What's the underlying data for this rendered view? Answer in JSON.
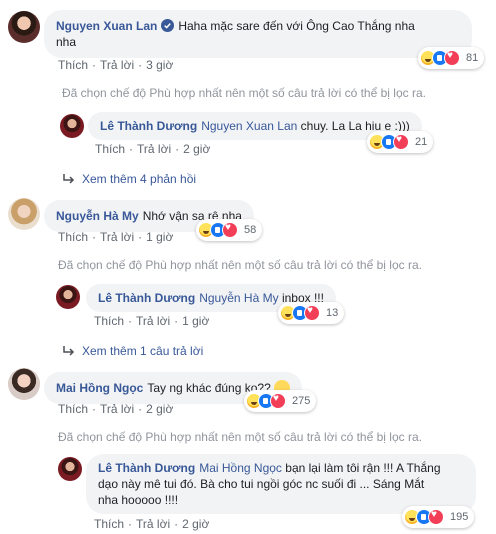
{
  "actions": {
    "like": "Thích",
    "reply": "Trả lời",
    "dot": "·"
  },
  "filter_note": "Đã chọn chế độ Phù hợp nhất nên một số câu trả lời có thể bị lọc ra.",
  "comments": [
    {
      "author": "Nguyen Xuan Lan",
      "verified": true,
      "text_line1": "Haha mặc sare đến với Ông Cao Thắng nha",
      "text_line2": "nha",
      "time": "3 giờ",
      "reaction_count": "81",
      "reply": {
        "author": "Lê Thành Dương",
        "mention": "Nguyen Xuan Lan",
        "text": "chuy. La La hiu e :)))",
        "time": "2 giờ",
        "reaction_count": "21"
      },
      "more_replies": "Xem thêm 4 phản hồi"
    },
    {
      "author": "Nguyễn Hà My",
      "text": "Nhớ vận sa rê nha",
      "time": "1 giờ",
      "reaction_count": "58",
      "reply": {
        "author": "Lê Thành Dương",
        "mention": "Nguyễn Hà My",
        "text": "inbox !!!",
        "time": "1 giờ",
        "reaction_count": "13"
      },
      "more_replies": "Xem thêm 1 câu trả lời"
    },
    {
      "author": "Mai Hồng Ngọc",
      "text": "Tay ng khác đúng ko??",
      "emoji": "thinking-face",
      "time": "2 giờ",
      "reaction_count": "275",
      "reply": {
        "author": "Lê Thành Dương",
        "mention": "Mai Hồng Ngọc",
        "text_line1": "bạn lại làm tôi rận !!! A Thắng",
        "text_line2": "dạo này mê tui đó. Bà cho tui ngồi góc nc suối đi ... Sáng Mắt",
        "text_line3": "nha hooooo !!!!",
        "time": "2 giờ",
        "reaction_count": "195"
      }
    }
  ],
  "colors": {
    "link": "#385898",
    "bubble": "#f2f3f5",
    "muted": "#90949c",
    "action": "#606770"
  }
}
